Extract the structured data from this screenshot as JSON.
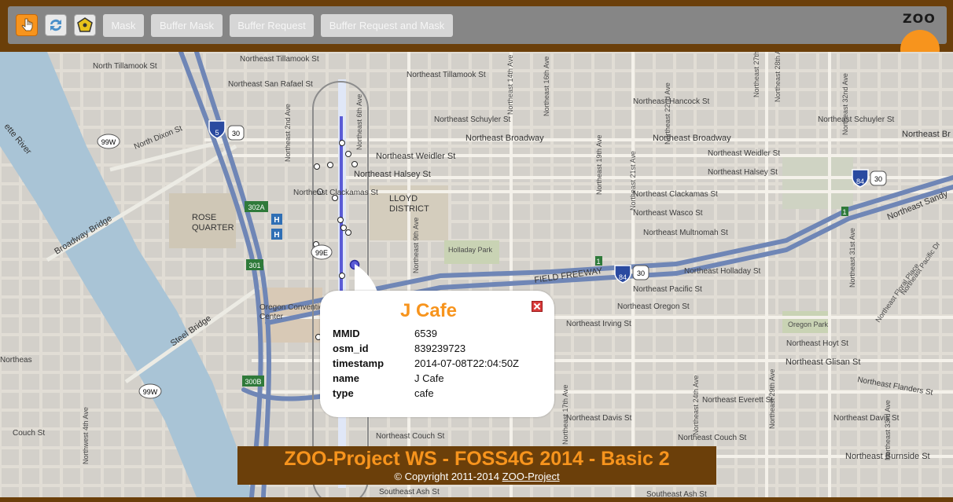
{
  "toolbar": {
    "icons": [
      "pan-hand-icon",
      "refresh-icon",
      "select-polygon-icon"
    ],
    "buttons": [
      "Mask",
      "Buffer Mask",
      "Buffer Request",
      "Buffer Request and Mask"
    ]
  },
  "logo": {
    "text": "ZOO"
  },
  "map": {
    "labels": {
      "ne_tillamook_1": "Northeast Tillamook St",
      "n_tillamook": "North Tillamook St",
      "ne_tillamook_2": "Northeast Tillamook St",
      "ne_san_rafael": "Northeast San Rafael St",
      "ne_hancock": "Northeast Hancock St",
      "ne_schuyler_1": "Northeast Schuyler St",
      "ne_schuyler_2": "Northeast Schuyler St",
      "ne_broadway_1": "Northeast Broadway",
      "ne_broadway_2": "Northeast Broadway",
      "northeast_br": "Northeast Br",
      "ne_weidler_1": "Northeast Weidler St",
      "ne_weidler_2": "Northeast Weidler St",
      "ne_halsey_1": "Northeast Halsey St",
      "ne_halsey_2": "Northeast Halsey St",
      "ne_clackamas_1": "Northeast Clackamas St",
      "ne_clackamas_2": "Northeast Clackamas St",
      "ne_wasco": "Northeast Wasco St",
      "ne_multnomah": "Northeast Multnomah St",
      "ne_holladay": "Northeast Holladay St",
      "ne_pacific": "Northeast Pacific St",
      "ne_oregon": "Northeast Oregon St",
      "ne_irving": "Northeast Irving St",
      "ne_hoyt": "Northeast Hoyt St",
      "ne_glisan": "Northeast Glisan St",
      "ne_flanders": "Northeast Flanders St",
      "ne_everett": "Northeast Everett St",
      "ne_davis_1": "Northeast Davis St",
      "ne_davis_2": "Northeast Davis St",
      "ne_couch_1": "Northeast Couch St",
      "ne_couch_2": "Northeast Couch St",
      "ne_burnside": "Northeast Burnside St",
      "se_ash_1": "Southeast Ash St",
      "se_ash_2": "Southeast Ash St",
      "ne_sandy": "Northeast Sandy",
      "ne_2nd": "Northeast 2nd Ave",
      "ne_6th": "Northeast 6th Ave",
      "ne_9th": "Northeast 9th Ave",
      "ne_14th": "Northeast 14th Ave",
      "ne_16th": "Northeast 16th Ave",
      "ne_17th": "Northeast 17th Ave",
      "ne_19th": "Northeast 19th Ave",
      "ne_21st": "Northeast 21st Ave",
      "ne_22nd": "Northeast 22nd Ave",
      "ne_24th": "Northeast 24th Ave",
      "ne_27th": "Northeast 27th Ave",
      "ne_28th": "Northeast 28th Ave",
      "ne_29th": "Northeast 29th Ave",
      "ne_31st": "Northeast 31st Ave",
      "ne_32nd": "Northeast 32nd Ave",
      "ne_33rd": "Northeast 33rd Ave",
      "n_dixon": "North Dixon St",
      "nw_4th": "Northwest 4th Ave",
      "couch_st": "Couch St",
      "rose_quarter": "ROSE\nQUARTER",
      "lloyd_district": "LLOYD\nDISTRICT",
      "holladay_park": "Holladay Park",
      "oregon_park": "Oregon Park",
      "convention_center": "Oregon Convention\nCenter",
      "willamette_river": "ette River",
      "broadway_bridge": "Broadway Bridge",
      "steel_bridge": "Steel Bridge",
      "banfield_freeway": "FIELD FREEWAY",
      "ne_floral": "Northeast Floral Place",
      "ne_pacific_dr": "Northeast Pacific Dr",
      "northeast_left": "Northeas"
    },
    "shields": {
      "i5": "5",
      "us30_a": "30",
      "or99w_a": "99W",
      "or99w_b": "99W",
      "or99e": "99E",
      "exit302a": "302A",
      "exit301": "301",
      "exit300b": "300B",
      "exit1_a": "1",
      "exit1_b": "1",
      "i84_a": "84",
      "us30_b": "30",
      "i84_b": "84",
      "us30_c": "30",
      "hospital_a": "H",
      "hospital_b": "H"
    }
  },
  "popup": {
    "title": "J Cafe",
    "rows": [
      {
        "key": "MMID",
        "value": "6539"
      },
      {
        "key": "osm_id",
        "value": "839239723"
      },
      {
        "key": "timestamp",
        "value": "2014-07-08T22:04:50Z"
      },
      {
        "key": "name",
        "value": "J Cafe"
      },
      {
        "key": "type",
        "value": "cafe"
      }
    ]
  },
  "footer": {
    "title": "ZOO-Project WS - FOSS4G 2014 - Basic 2",
    "copyright": "© Copyright 2011-2014",
    "link": "ZOO-Project"
  },
  "colors": {
    "brown": "#6b3f0a",
    "orange": "#f7941d",
    "toolbar": "#868686",
    "river": "#a9c4d6",
    "freeway": "#6f86b6",
    "selection": "#5b5bd6"
  }
}
